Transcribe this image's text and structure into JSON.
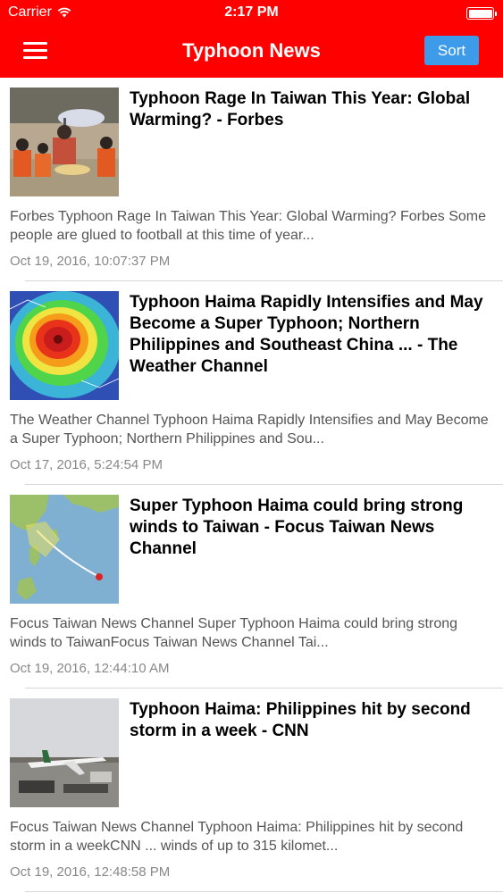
{
  "status_bar": {
    "carrier": "Carrier",
    "time": "2:17 PM"
  },
  "nav": {
    "title": "Typhoon News",
    "sort_label": "Sort"
  },
  "colors": {
    "brand": "#ff0000",
    "button": "#3d9be9"
  },
  "articles": [
    {
      "headline": "Typhoon Rage In Taiwan This Year: Global Warming? - Forbes",
      "summary": "Forbes    Typhoon Rage In Taiwan This Year: Global Warming? Forbes  Some people are glued to football at this time of year...",
      "date": "Oct 19, 2016, 10:07:37 PM"
    },
    {
      "headline": "Typhoon Haima Rapidly Intensifies and May Become a Super Typhoon; Northern Philippines and Southeast China ... - The Weather Channel",
      "summary": "The Weather Channel    Typhoon Haima Rapidly Intensifies and May Become a Super Typhoon; Northern Philippines and Sou...",
      "date": "Oct 17, 2016, 5:24:54 PM"
    },
    {
      "headline": "Super Typhoon Haima could bring strong winds to Taiwan - Focus Taiwan News Channel",
      "summary": "Focus Taiwan News Channel    Super Typhoon Haima could bring strong winds to TaiwanFocus Taiwan News Channel  Tai...",
      "date": "Oct 19, 2016, 12:44:10 AM"
    },
    {
      "headline": "Typhoon Haima: Philippines hit by second storm in a week - CNN",
      "summary": "Focus Taiwan News Channel    Typhoon Haima: Philippines hit by second storm in a weekCNN  ... winds of up to 315 kilomet...",
      "date": "Oct 19, 2016, 12:48:58 PM"
    }
  ]
}
